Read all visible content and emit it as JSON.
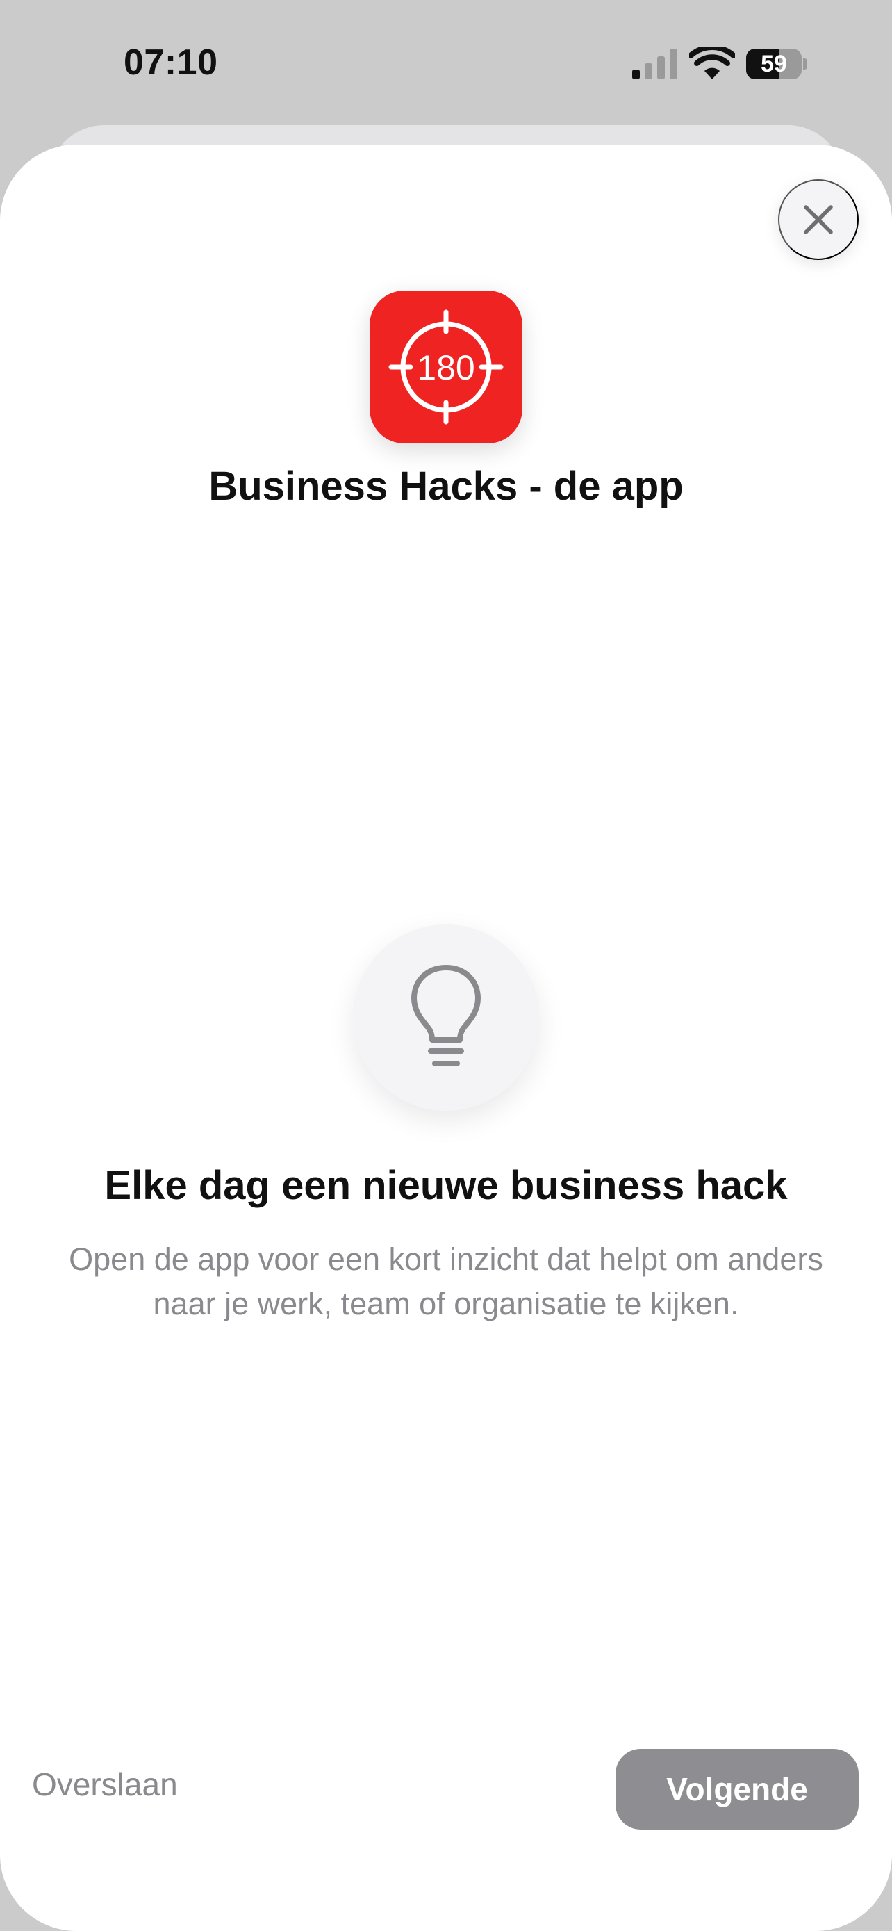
{
  "status_bar": {
    "time": "07:10",
    "battery_percent": "59",
    "battery_level": 0.59,
    "icons": [
      "signal-icon",
      "wifi-icon",
      "battery-icon"
    ]
  },
  "sheet": {
    "close_icon": "close-icon",
    "app_icon_text": "180",
    "app_icon_color": "#f02323",
    "app_title": "Business Hacks - de app",
    "feature_icon": "lightbulb-icon",
    "headline": "Elke dag een nieuwe business hack",
    "body": "Open de app voor een kort inzicht dat helpt om anders naar je werk, team of organisatie te kijken.",
    "skip_label": "Overslaan",
    "next_label": "Volgende"
  },
  "colors": {
    "accent_red": "#f02323",
    "secondary_text": "#8a8a8e",
    "next_button_bg": "#8e8e92",
    "page_bg": "#cbcbcb"
  }
}
